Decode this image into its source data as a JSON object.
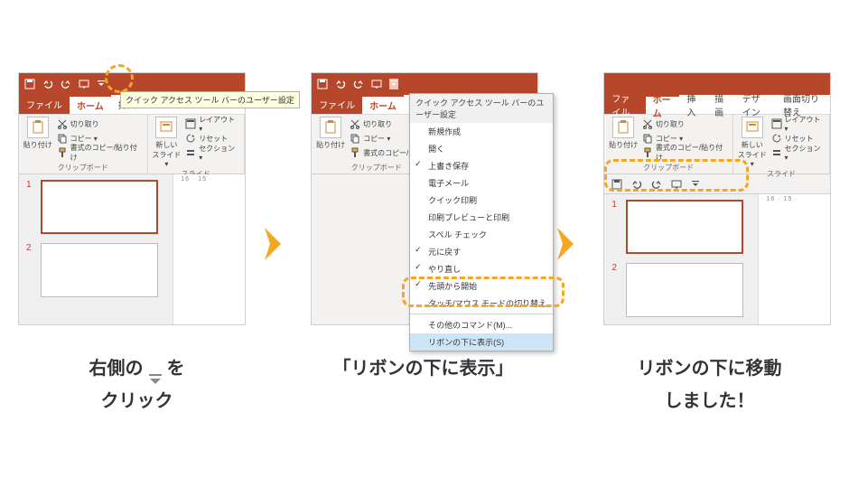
{
  "colors": {
    "brand": "#b7472a",
    "highlight": "#f5a623"
  },
  "qat_tooltip": "クイック アクセス ツール バーのユーザー設定",
  "tabs": {
    "file": "ファイル",
    "home": "ホーム",
    "insert": "挿入",
    "draw": "描画",
    "design": "デザイン",
    "transition": "画面切り替え"
  },
  "ribbon": {
    "clipboard": {
      "paste": "貼り付け",
      "cut": "切り取り",
      "copy": "コピー ▾",
      "format_painter": "書式のコピー/貼り付け",
      "group_label": "クリップボード"
    },
    "slides": {
      "new_slide": "新しい\nスライド ▾",
      "layout": "レイアウト ▾",
      "reset": "リセット",
      "section": "セクション ▾",
      "group_label": "スライド"
    }
  },
  "ruler_text": "· 16 · 15 ·",
  "thumbs": {
    "n1": "1",
    "n2": "2"
  },
  "dropdown": {
    "title": "クイック アクセス ツール バーのユーザー設定",
    "items": [
      {
        "label": "新規作成",
        "checked": false
      },
      {
        "label": "開く",
        "checked": false
      },
      {
        "label": "上書き保存",
        "checked": true
      },
      {
        "label": "電子メール",
        "checked": false
      },
      {
        "label": "クイック印刷",
        "checked": false
      },
      {
        "label": "印刷プレビューと印刷",
        "checked": false
      },
      {
        "label": "スペル チェック",
        "checked": false
      },
      {
        "label": "元に戻す",
        "checked": true
      },
      {
        "label": "やり直し",
        "checked": true
      },
      {
        "label": "先頭から開始",
        "checked": true
      },
      {
        "label": "タッチ/マウス モードの切り替え",
        "checked": false
      },
      {
        "label": "その他のコマンド(M)...",
        "checked": false
      },
      {
        "label": "リボンの下に表示(S)",
        "checked": false,
        "hover": true
      }
    ]
  },
  "captions": {
    "c1a": "右側の",
    "c1b": "を",
    "c1c": "クリック",
    "c2": "「リボンの下に表示」",
    "c3a": "リボンの下に移動",
    "c3b": "しました！"
  },
  "icons": {
    "save": "save-icon",
    "undo": "undo-icon",
    "redo": "redo-icon",
    "start": "start-icon",
    "dropdown": "chevron-down-icon"
  }
}
